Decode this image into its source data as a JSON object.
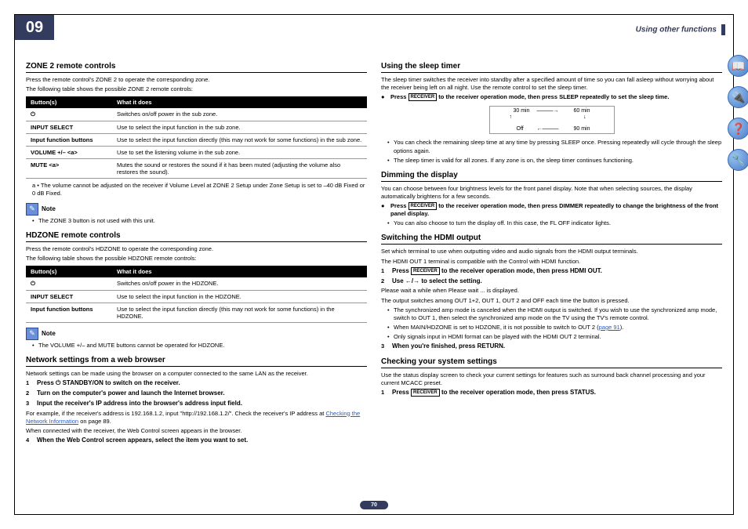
{
  "chapter": "09",
  "header": "Using other functions",
  "pageNum": "70",
  "left": {
    "s1": {
      "title": "ZONE 2 remote controls",
      "intro1": "Press the remote control's ZONE 2 to operate the corresponding zone.",
      "intro2": "The following table shows the possible ZONE 2 remote controls:",
      "th1": "Button(s)",
      "th2": "What it does",
      "r1a": "⏻",
      "r1b": "Switches on/off power in the sub zone.",
      "r2a": "INPUT SELECT",
      "r2b": "Use to select the input function in the sub zone.",
      "r3a": "Input function buttons",
      "r3b": "Use to select the input function directly (this may not work for some functions) in the sub zone.",
      "r4a": "VOLUME +/–\n<a>",
      "r4b": "Use to set the listening volume in the sub zone.",
      "r5a": "MUTE\n<a>",
      "r5b": "Mutes the sound or restores the sound if it has been muted (adjusting the volume also restores the sound).",
      "foot": "a • The volume cannot be adjusted on the receiver if Volume Level at ZONE 2 Setup under Zone Setup is set to –40 dB Fixed or 0 dB Fixed.",
      "note": "The ZONE 3 button is not used with this unit."
    },
    "s2": {
      "title": "HDZONE remote controls",
      "intro1": "Press the remote control's HDZONE to operate the corresponding zone.",
      "intro2": "The following table shows the possible HDZONE remote controls:",
      "th1": "Button(s)",
      "th2": "What it does",
      "r1a": "⏻",
      "r1b": "Switches on/off power in the HDZONE.",
      "r2a": "INPUT SELECT",
      "r2b": "Use to select the input function in the HDZONE.",
      "r3a": "Input function buttons",
      "r3b": "Use to select the input function directly (this may not work for some functions) in the HDZONE.",
      "note": "The VOLUME +/– and MUTE buttons cannot be operated for HDZONE."
    },
    "s3": {
      "title": "Network settings from a web browser",
      "intro": "Network settings can be made using the browser on a computer connected to the same LAN as the receiver.",
      "st1": "Press ⏻ STANDBY/ON to switch on the receiver.",
      "st2": "Turn on the computer's power and launch the Internet browser.",
      "st3": "Input the receiver's IP address into the browser's address input field.",
      "p1": "For example, if the receiver's address is 192.168.1.2, input \"http://192.168.1.2/\". Check the receiver's IP address at ",
      "link": "Checking the Network Information",
      "p1b": " on page 89.",
      "p2": "When connected with the receiver, the Web Control screen appears in the browser.",
      "st4": "When the Web Control screen appears, select the item you want to set."
    }
  },
  "right": {
    "s1": {
      "title": "Using the sleep timer",
      "intro": "The sleep timer switches the receiver into standby after a specified amount of time so you can fall asleep without worrying about the receiver being left on all night. Use the remote control to set the sleep timer.",
      "step": " to the receiver operation mode, then press SLEEP  repeatedly to set the sleep time.",
      "d30": "30 min",
      "d60": "60 min",
      "doff": "Off",
      "d90": "90 min",
      "b1": "You can check the remaining sleep time at any time by pressing SLEEP once. Pressing repeatedly will cycle through the sleep options again.",
      "b2": "The sleep timer is valid for all zones. If any zone is on, the sleep timer continues functioning."
    },
    "s2": {
      "title": "Dimming the display",
      "intro": "You can choose between four brightness levels for the front panel display. Note that when selecting sources, the display automatically brightens for a few seconds.",
      "step": " to the receiver operation mode, then press DIMMER  repeatedly to change the brightness of the front panel display.",
      "b1": "You can also choose to turn the display off. In this case, the FL OFF indicator lights."
    },
    "s3": {
      "title": "Switching the HDMI output",
      "p1": "Set which terminal to use when outputting video and audio signals from the HDMI output terminals.",
      "p2": "The HDMI OUT 1 terminal is compatible with the Control with HDMI function.",
      "st1": " to the receiver operation mode, then press HDMI OUT.",
      "st2": "Use ←/→ to select the setting.",
      "p3": "Please wait a while when Please wait ... is displayed.",
      "p4": "The output switches among OUT 1+2, OUT 1, OUT 2 and OFF each time the button is pressed.",
      "b1": "The synchronized amp mode is canceled when the HDMI output is switched. If you wish to use the synchronized amp mode, switch to OUT 1, then select the synchronized amp mode on the TV using the TV's remote control.",
      "b2a": "When MAIN/HDZONE is set to HDZONE, it is not possible to switch to OUT 2 (",
      "b2link": "page 91",
      "b2b": ").",
      "b3": "Only signals input in HDMI format can be played with the HDMI OUT 2 terminal.",
      "st3": "When you're finished, press RETURN."
    },
    "s4": {
      "title": "Checking your system settings",
      "intro": "Use the status display screen to check your current settings for features such as surround back channel processing and your current MCACC preset.",
      "st1": " to the receiver operation mode, then press STATUS."
    }
  },
  "noteLabel": "Note",
  "receiver": "RECEIVER",
  "press": "Press "
}
